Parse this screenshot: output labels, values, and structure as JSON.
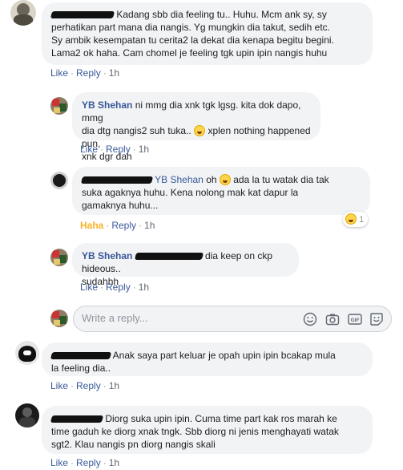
{
  "comments": [
    {
      "text": "Kadang sbb dia feeling tu.. Huhu. Mcm ank sy, sy perhatikan part mana dia nangis. Yg mungkin dia takut, sedih etc. Sy ambik kesempatan tu cerita2 la dekat dia kenapa begitu begini. Lama2 ok haha. Cam chomel je feeling tgk upin ipin nangis huhu",
      "line1": "Kadang sbb dia feeling tu.. Huhu. Mcm ank sy, sy",
      "line2": "perhatikan part mana dia nangis. Yg mungkin dia takut, sedih etc.",
      "line3": "Sy ambik kesempatan tu cerita2 la dekat dia kenapa begitu begini.",
      "line4": "Lama2 ok haha. Cam chomel je feeling tgk upin ipin nangis huhu",
      "like": "Like",
      "reply": "Reply",
      "time": "1h"
    },
    {
      "text": "Anak saya part keluar je opah upin ipin bcakap mula la feeling dia..",
      "line1": "Anak saya part keluar je opah upin ipin bcakap mula",
      "line2": "la feeling dia..",
      "like": "Like",
      "reply": "Reply",
      "time": "1h"
    },
    {
      "text": "Diorg suka upin ipin. Cuma time part kak ros marah ke time gaduh ke diorg xnak tngk. Sbb diorg ni jenis menghayati watak sgt2. Klau nangis pn diorg nangis skali",
      "line1": "Diorg suka upin ipin. Cuma time part kak ros marah ke",
      "line2": "time gaduh ke diorg xnak tngk. Sbb diorg ni jenis menghayati watak",
      "line3": "sgt2. Klau nangis pn diorg nangis skali",
      "like": "Like",
      "reply": "Reply",
      "time": "1h"
    }
  ],
  "replies": [
    {
      "author": "YB Shehan",
      "line1": "ni mmg dia xnk tgk lgsg. kita dok dapo, mmg",
      "line2a": "dia dtg nangis2 suh tuka..",
      "line2b": "xplen nothing happened pun,",
      "line3": "xnk dgr dah",
      "like": "Like",
      "reply": "Reply",
      "time": "1h"
    },
    {
      "tag": "YB Shehan",
      "line1a": "oh",
      "line1b": "ada la tu watak dia tak",
      "line2": "suka agaknya huhu. Kena nolong mak kat dapur la",
      "line3": "gamaknya huhu...",
      "reaction_label": "Haha",
      "reply": "Reply",
      "time": "1h",
      "reaction_count": "1"
    },
    {
      "author": "YB Shehan",
      "line1": "dia keep on ckp hideous..",
      "line2": "sudahhh",
      "like": "Like",
      "reply": "Reply",
      "time": "1h"
    }
  ],
  "reply_box": {
    "placeholder": "Write a reply..."
  },
  "separator": "·",
  "colors": {
    "link": "#385898",
    "bubble": "#f2f3f5",
    "haha": "#f7b125",
    "meta": "#616770"
  },
  "icons": [
    "smiley-icon",
    "camera-icon",
    "gif-icon",
    "sticker-icon"
  ]
}
